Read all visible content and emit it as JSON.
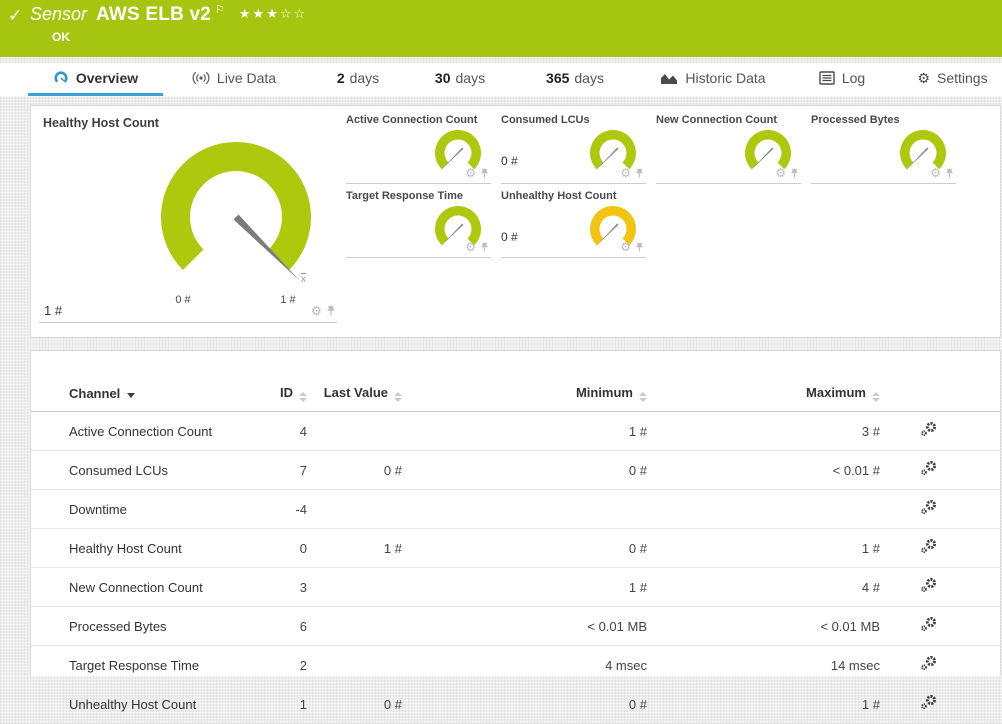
{
  "colors": {
    "header_green": "#a6c50f",
    "gauge_green": "#aec80e",
    "gauge_yellow": "#f3c40f",
    "accent_blue": "#3aa2d8",
    "needle_gray": "#7c7c7c"
  },
  "icons": {
    "check": "✓",
    "flag": "⚐",
    "gear": "⚙"
  },
  "header": {
    "type_label": "Sensor",
    "title": "AWS ELB v2",
    "status": "OK",
    "stars": "★★★☆☆",
    "rating_filled": 3,
    "rating_total": 5
  },
  "tabs": [
    {
      "label": "Overview",
      "icon": "gauge-icon",
      "active": true
    },
    {
      "label": "Live Data",
      "icon": "broadcast-icon"
    },
    {
      "num": "2",
      "label": "days"
    },
    {
      "num": "30",
      "label": "days"
    },
    {
      "num": "365",
      "label": "days"
    },
    {
      "label": "Historic Data",
      "icon": "area-chart-icon"
    },
    {
      "label": "Log",
      "icon": "log-icon"
    },
    {
      "label": "Settings",
      "icon": "gear-icon"
    }
  ],
  "gauges": {
    "main": {
      "title": "Healthy Host Count",
      "value": "1 #",
      "scale_min": "0 #",
      "scale_max": "1 #",
      "avg_marker": "x"
    },
    "small": [
      {
        "title": "Active Connection Count",
        "value": ""
      },
      {
        "title": "Consumed LCUs",
        "value": "0 #"
      },
      {
        "title": "New Connection Count",
        "value": ""
      },
      {
        "title": "Processed Bytes",
        "value": ""
      },
      {
        "title": "Target Response Time",
        "value": ""
      },
      {
        "title": "Unhealthy Host Count",
        "value": "0 #"
      }
    ]
  },
  "table": {
    "columns": {
      "channel": "Channel",
      "id": "ID",
      "last_value": "Last Value",
      "minimum": "Minimum",
      "maximum": "Maximum"
    },
    "rows": [
      {
        "channel": "Active Connection Count",
        "id": "4",
        "last": "",
        "min": "1 #",
        "max": "3 #"
      },
      {
        "channel": "Consumed LCUs",
        "id": "7",
        "last": "0 #",
        "min": "0 #",
        "max": "< 0.01 #"
      },
      {
        "channel": "Downtime",
        "id": "-4",
        "last": "",
        "min": "",
        "max": ""
      },
      {
        "channel": "Healthy Host Count",
        "id": "0",
        "last": "1 #",
        "min": "0 #",
        "max": "1 #"
      },
      {
        "channel": "New Connection Count",
        "id": "3",
        "last": "",
        "min": "1 #",
        "max": "4 #"
      },
      {
        "channel": "Processed Bytes",
        "id": "6",
        "last": "",
        "min": "< 0.01 MB",
        "max": "< 0.01 MB"
      },
      {
        "channel": "Target Response Time",
        "id": "2",
        "last": "",
        "min": "4 msec",
        "max": "14 msec"
      },
      {
        "channel": "Unhealthy Host Count",
        "id": "1",
        "last": "0 #",
        "min": "0 #",
        "max": "1 #"
      }
    ]
  }
}
